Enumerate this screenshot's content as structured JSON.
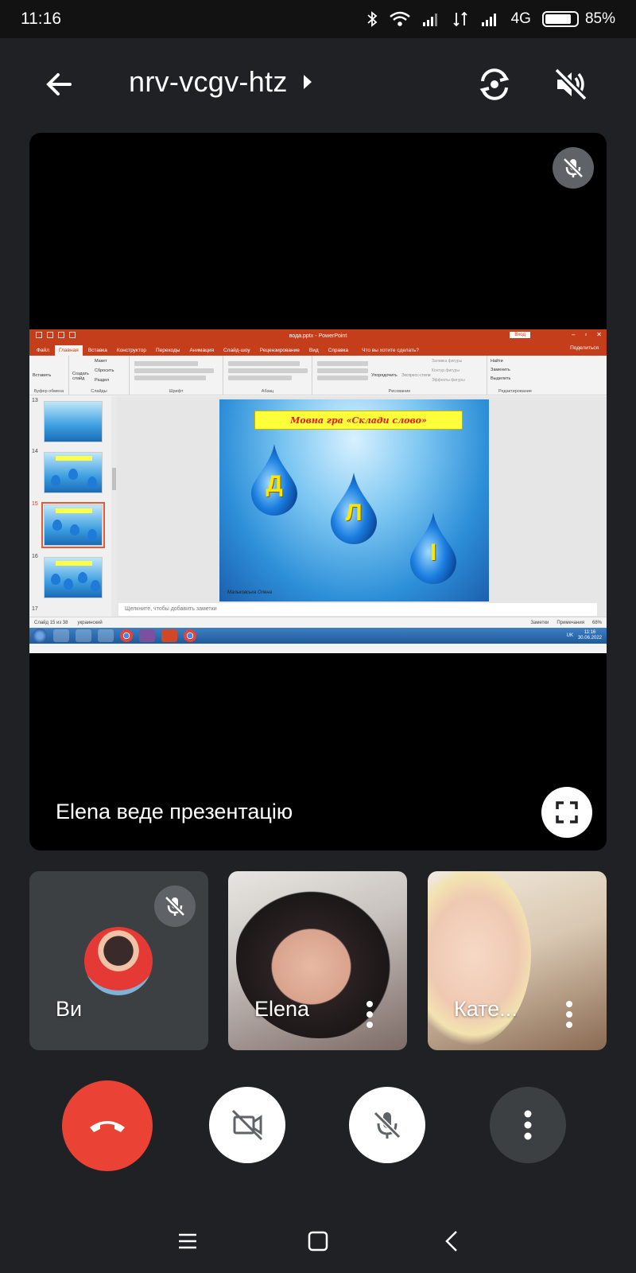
{
  "status_bar": {
    "time": "11:16",
    "network": "4G",
    "battery": "85%",
    "battery_level": 0.85,
    "icons": [
      "bluetooth-icon",
      "wifi-icon",
      "signal-icon",
      "signal-icon",
      "signal-icon"
    ]
  },
  "top_bar": {
    "meeting_code": "nrv-vcgv-htz",
    "icons": [
      "back-arrow-icon",
      "chevron-right-icon",
      "switch-camera-icon",
      "speaker-off-icon"
    ]
  },
  "presentation": {
    "presenter_label": "Elena веде презентацію",
    "icons": [
      "mic-off-icon",
      "fullscreen-icon"
    ],
    "shared_screen": {
      "window_title": "вода.pptx - PowerPoint",
      "login_button": "Вход",
      "tabs": [
        "Файл",
        "Главная",
        "Вставка",
        "Конструктор",
        "Переходы",
        "Анимация",
        "Слайд-шоу",
        "Рецензирование",
        "Вид",
        "Справка"
      ],
      "active_tab": "Главная",
      "tell_me": "Что вы хотите сделать?",
      "share": "Поделиться",
      "ribbon_groups": [
        "Буфер обмена",
        "Слайды",
        "Шрифт",
        "Абзац",
        "Рисование",
        "Редактирование"
      ],
      "ribbon_items": {
        "paste": "Вставить",
        "new_slide": "Создать слайд",
        "layout": "Макет",
        "reset": "Сбросить",
        "section": "Раздел",
        "arrange": "Упорядочить",
        "quick_styles": "Экспресс-стили",
        "find": "Найти",
        "replace": "Заменить",
        "select": "Выделить",
        "shape_fill": "Заливка фигуры",
        "shape_outline": "Контур фигуры",
        "shape_effects": "Эффекты фигуры"
      },
      "slide_numbers": [
        "13",
        "14",
        "15",
        "16",
        "17"
      ],
      "selected_slide": "15",
      "slide": {
        "banner": "Мовна гра «Склади слово»",
        "letters": [
          "Д",
          "Л",
          "І"
        ],
        "signature": "Мальковська Олена"
      },
      "notes_placeholder": "Щелкните, чтобы добавить заметки",
      "status_left": "Слайд 15 из 38",
      "language": "украинский",
      "notes_btn": "Заметки",
      "comments_btn": "Примечания",
      "zoom": "68%",
      "taskbar": {
        "lang": "UK",
        "clock_time": "11:16",
        "clock_date": "30.06.2022"
      }
    }
  },
  "participants": [
    {
      "name": "Ви",
      "muted": true
    },
    {
      "name": "Elena",
      "muted": false
    },
    {
      "name": "Кате...",
      "muted": false
    }
  ],
  "controls": {
    "icons": [
      "end-call-icon",
      "camera-off-icon",
      "mic-off-icon",
      "more-vert-icon"
    ]
  },
  "nav_bar": {
    "icons": [
      "menu-icon",
      "home-icon",
      "back-icon"
    ]
  },
  "colors": {
    "end_call": "#ea4335",
    "background": "#202124",
    "tile": "#3c4043",
    "ppt_accent": "#c43e1c"
  }
}
